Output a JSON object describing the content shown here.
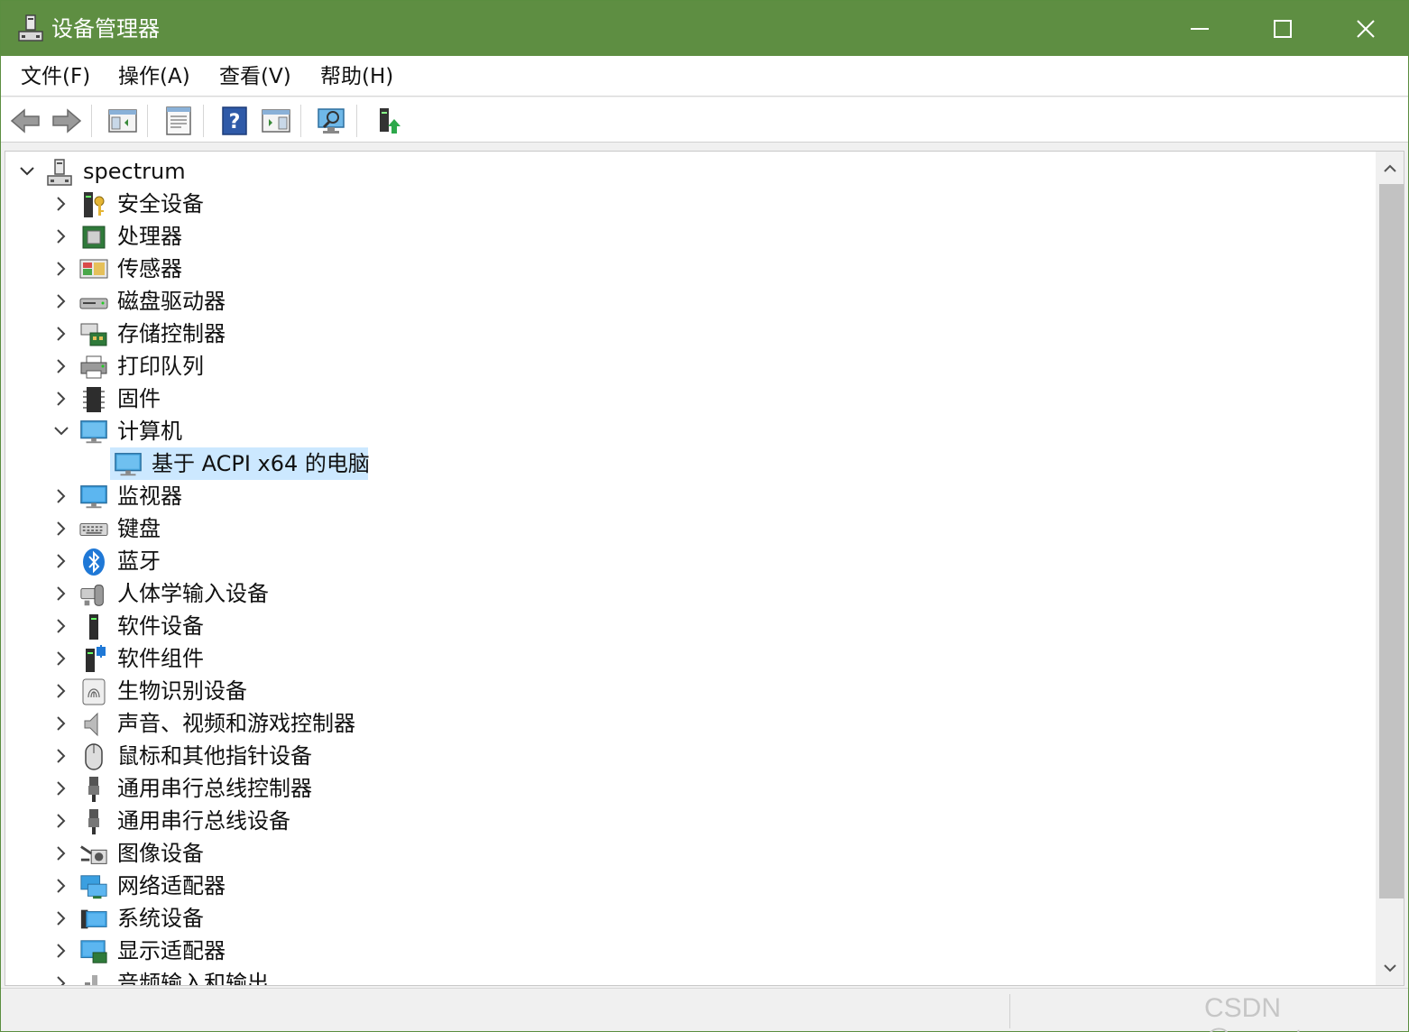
{
  "window": {
    "title": "设备管理器",
    "accent_color": "#5e8e42",
    "minimize_icon": "minimize-icon",
    "maximize_icon": "maximize-icon",
    "close_icon": "close-icon"
  },
  "menu": [
    "文件(F)",
    "操作(A)",
    "查看(V)",
    "帮助(H)"
  ],
  "toolbar": [
    "back-arrow-icon",
    "forward-arrow-icon",
    "show-hide-tree-icon",
    "properties-icon",
    "help-icon",
    "action-pane-icon",
    "scan-hardware-icon",
    "update-driver-icon"
  ],
  "tree": {
    "root": "spectrum",
    "items": [
      {
        "label": "安全设备",
        "icon": "security-device-icon"
      },
      {
        "label": "处理器",
        "icon": "processor-icon"
      },
      {
        "label": "传感器",
        "icon": "sensor-icon"
      },
      {
        "label": "磁盘驱动器",
        "icon": "disk-drive-icon"
      },
      {
        "label": "存储控制器",
        "icon": "storage-controller-icon"
      },
      {
        "label": "打印队列",
        "icon": "printer-icon"
      },
      {
        "label": "固件",
        "icon": "firmware-icon"
      },
      {
        "label": "计算机",
        "icon": "computer-icon",
        "expanded": true,
        "children": [
          {
            "label": "基于 ACPI x64 的电脑",
            "icon": "computer-icon",
            "selected": true
          }
        ]
      },
      {
        "label": "监视器",
        "icon": "monitor-icon"
      },
      {
        "label": "键盘",
        "icon": "keyboard-icon"
      },
      {
        "label": "蓝牙",
        "icon": "bluetooth-icon"
      },
      {
        "label": "人体学输入设备",
        "icon": "hid-icon"
      },
      {
        "label": "软件设备",
        "icon": "software-device-icon"
      },
      {
        "label": "软件组件",
        "icon": "software-component-icon"
      },
      {
        "label": "生物识别设备",
        "icon": "biometric-icon"
      },
      {
        "label": "声音、视频和游戏控制器",
        "icon": "sound-icon"
      },
      {
        "label": "鼠标和其他指针设备",
        "icon": "mouse-icon"
      },
      {
        "label": "通用串行总线控制器",
        "icon": "usb-controller-icon"
      },
      {
        "label": "通用串行总线设备",
        "icon": "usb-device-icon"
      },
      {
        "label": "图像设备",
        "icon": "camera-icon"
      },
      {
        "label": "网络适配器",
        "icon": "network-adapter-icon"
      },
      {
        "label": "系统设备",
        "icon": "system-device-icon"
      },
      {
        "label": "显示适配器",
        "icon": "display-adapter-icon"
      },
      {
        "label": "音频输入和输出",
        "icon": "audio-io-icon"
      }
    ]
  },
  "watermark": "CSDN @wespten"
}
